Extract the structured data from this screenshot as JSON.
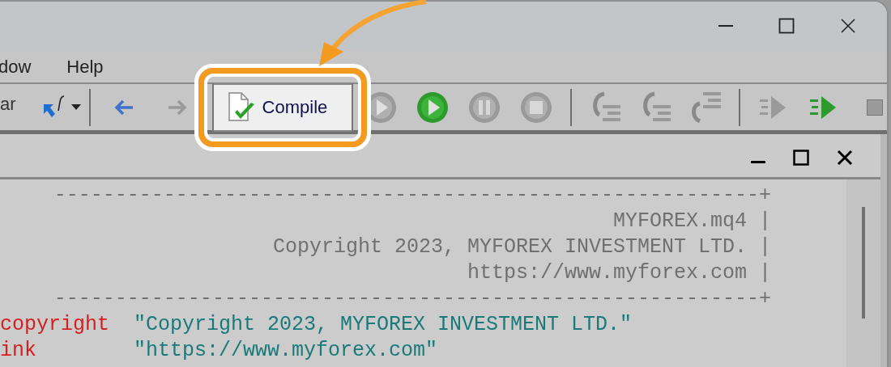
{
  "menu": [
    {
      "label": "dow"
    },
    {
      "label": "Help"
    }
  ],
  "toolbar": {
    "items": [
      {
        "kind": "label",
        "text": "ar"
      },
      {
        "kind": "function"
      },
      {
        "kind": "sep"
      },
      {
        "kind": "back",
        "disabled": false
      },
      {
        "kind": "forward",
        "disabled": true
      },
      {
        "kind": "compile",
        "text": "Compile",
        "highlighted": true
      },
      {
        "kind": "play-grey"
      },
      {
        "kind": "play-green"
      },
      {
        "kind": "pause"
      },
      {
        "kind": "stop"
      },
      {
        "kind": "sep"
      },
      {
        "kind": "step-into"
      },
      {
        "kind": "step-over"
      },
      {
        "kind": "step-out"
      },
      {
        "kind": "sep"
      },
      {
        "kind": "run-grey"
      },
      {
        "kind": "run-green"
      },
      {
        "kind": "square"
      }
    ]
  },
  "editor": {
    "lines": [
      {
        "kind": "rule",
        "text": "----------------------------------------------------------+"
      },
      {
        "kind": "comment",
        "text": "MYFOREX.mq4 |"
      },
      {
        "kind": "comment",
        "text": "Copyright 2023, MYFOREX INVESTMENT LTD. |"
      },
      {
        "kind": "comment",
        "text": "https://www.myforex.com |"
      },
      {
        "kind": "rule",
        "text": "----------------------------------------------------------+"
      },
      {
        "kind": "property",
        "name": "copyright",
        "value": "\"Copyright 2023, MYFOREX INVESTMENT LTD.\""
      },
      {
        "kind": "property",
        "name": "ink",
        "value": "\"https://www.myforex.com\""
      }
    ]
  }
}
